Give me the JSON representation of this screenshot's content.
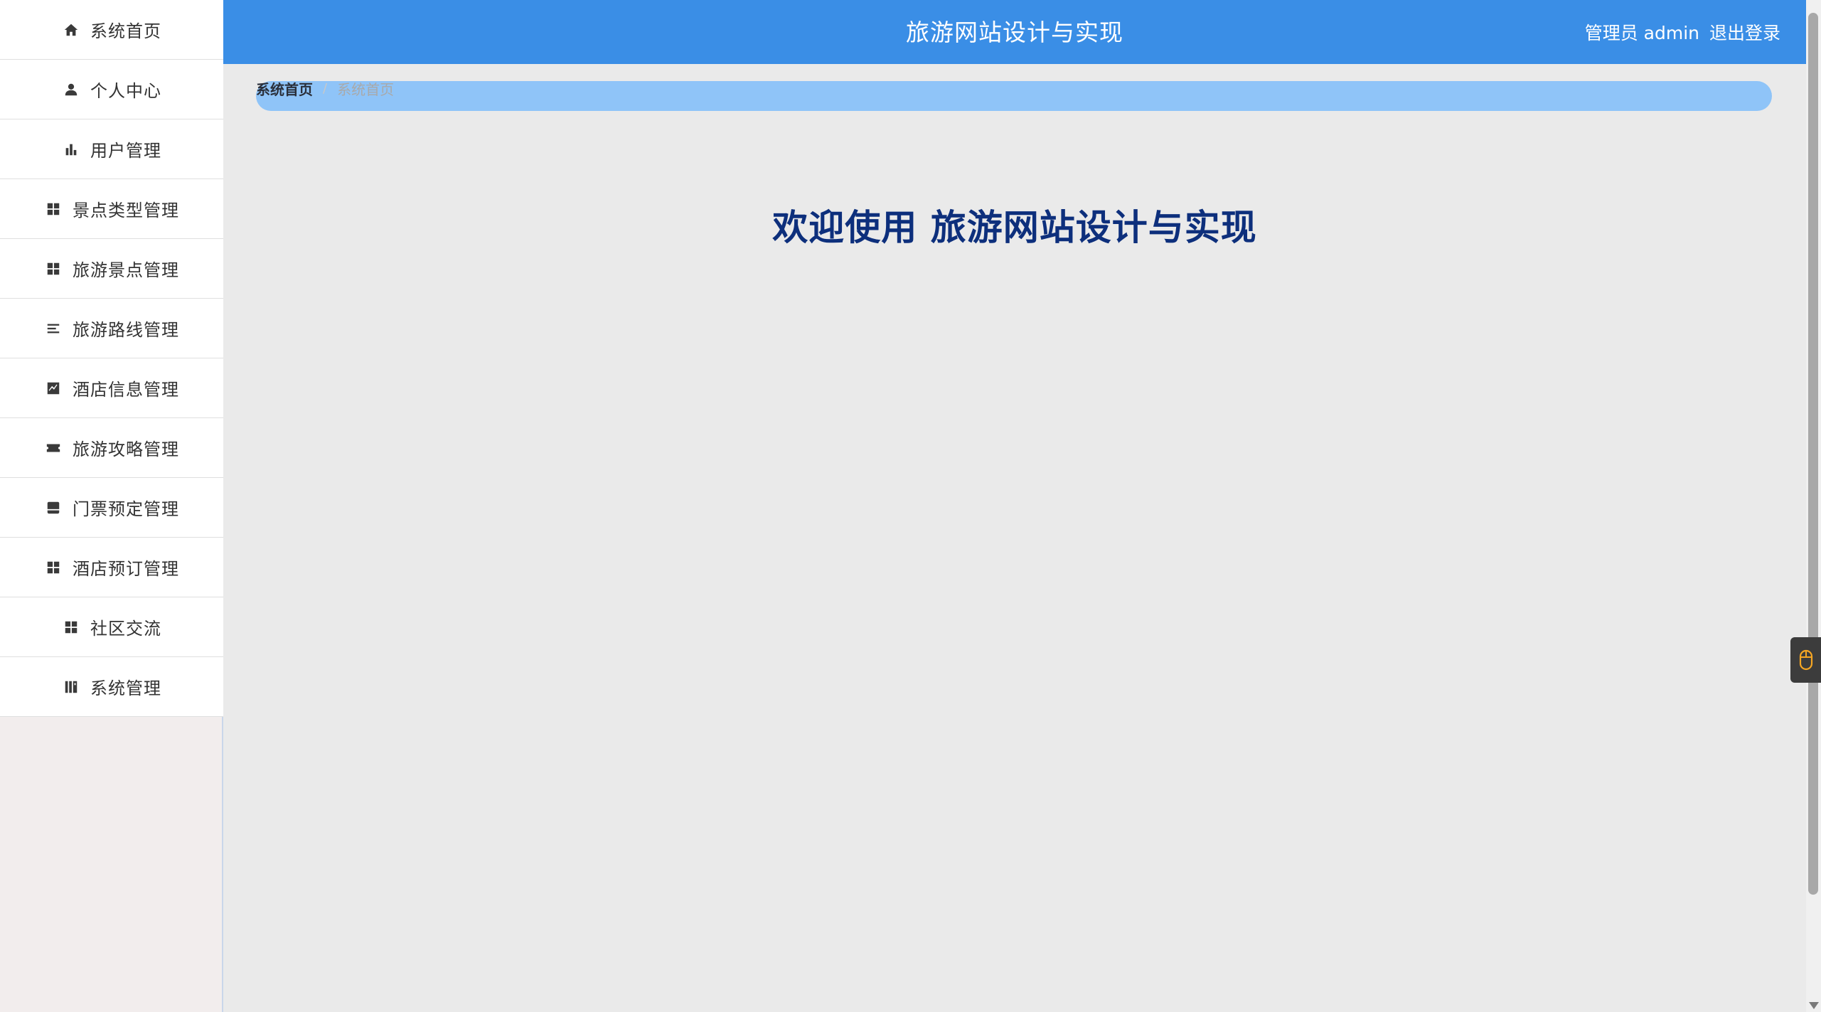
{
  "app": {
    "title": "旅游网站设计与实现"
  },
  "header": {
    "user_role": "管理员 admin",
    "logout_label": "退出登录"
  },
  "sidebar": {
    "items": [
      {
        "label": "系统首页",
        "icon": "home-icon"
      },
      {
        "label": "个人中心",
        "icon": "person-icon"
      },
      {
        "label": "用户管理",
        "icon": "bar-chart-icon"
      },
      {
        "label": "景点类型管理",
        "icon": "grid-icon"
      },
      {
        "label": "旅游景点管理",
        "icon": "grid-icon"
      },
      {
        "label": "旅游路线管理",
        "icon": "list-lines-icon"
      },
      {
        "label": "酒店信息管理",
        "icon": "trend-chart-icon"
      },
      {
        "label": "旅游攻略管理",
        "icon": "ticket-icon"
      },
      {
        "label": "门票预定管理",
        "icon": "tray-icon"
      },
      {
        "label": "酒店预订管理",
        "icon": "grid-icon"
      },
      {
        "label": "社区交流",
        "icon": "grid-icon"
      },
      {
        "label": "系统管理",
        "icon": "settings-book-icon"
      }
    ]
  },
  "breadcrumb": {
    "root": "系统首页",
    "separator": "/",
    "current": "系统首页"
  },
  "main": {
    "welcome": "欢迎使用 旅游网站设计与实现"
  },
  "colors": {
    "header_bg": "#3a8ee6",
    "breadcrumb_bg": "#8fc4f8",
    "welcome_text": "#0d2f7c",
    "page_bg": "#eaeaea"
  }
}
